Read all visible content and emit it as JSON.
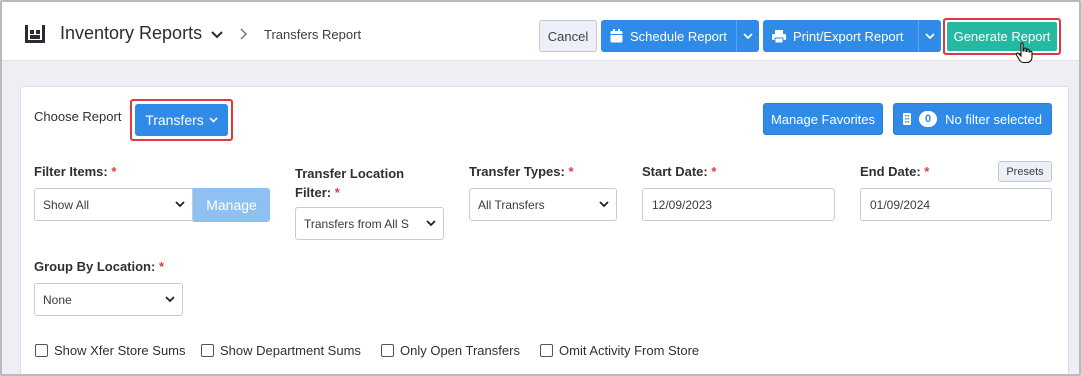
{
  "header": {
    "app_title": "Inventory Reports",
    "breadcrumb": "Transfers Report",
    "cancel_label": "Cancel",
    "schedule_label": "Schedule Report",
    "print_label": "Print/Export Report",
    "generate_label": "Generate Report"
  },
  "toolbar": {
    "choose_report_label": "Choose Report",
    "report_selected": "Transfers",
    "manage_favorites_label": "Manage Favorites",
    "filter_count": "0",
    "filter_status": "No filter selected"
  },
  "filters": {
    "items_label": "Filter Items:",
    "items_value": "Show All",
    "manage_label": "Manage",
    "location_label_1": "Transfer Location",
    "location_label_2": "Filter:",
    "location_value": "Transfers from All S",
    "types_label": "Transfer Types:",
    "types_value": "All Transfers",
    "start_label": "Start Date:",
    "start_value": "12/09/2023",
    "end_label": "End Date:",
    "end_value": "01/09/2024",
    "presets_label": "Presets",
    "group_label": "Group By Location:",
    "group_value": "None",
    "required_mark": "*"
  },
  "options": {
    "xfer_store_sums": "Show Xfer Store Sums",
    "department_sums": "Show Department Sums",
    "open_transfers": "Only Open Transfers",
    "omit_activity": "Omit Activity From Store"
  },
  "colors": {
    "primary": "#2f8ae8",
    "generate": "#26b9a1",
    "highlight": "#e0383e",
    "required": "#e03c3c"
  }
}
